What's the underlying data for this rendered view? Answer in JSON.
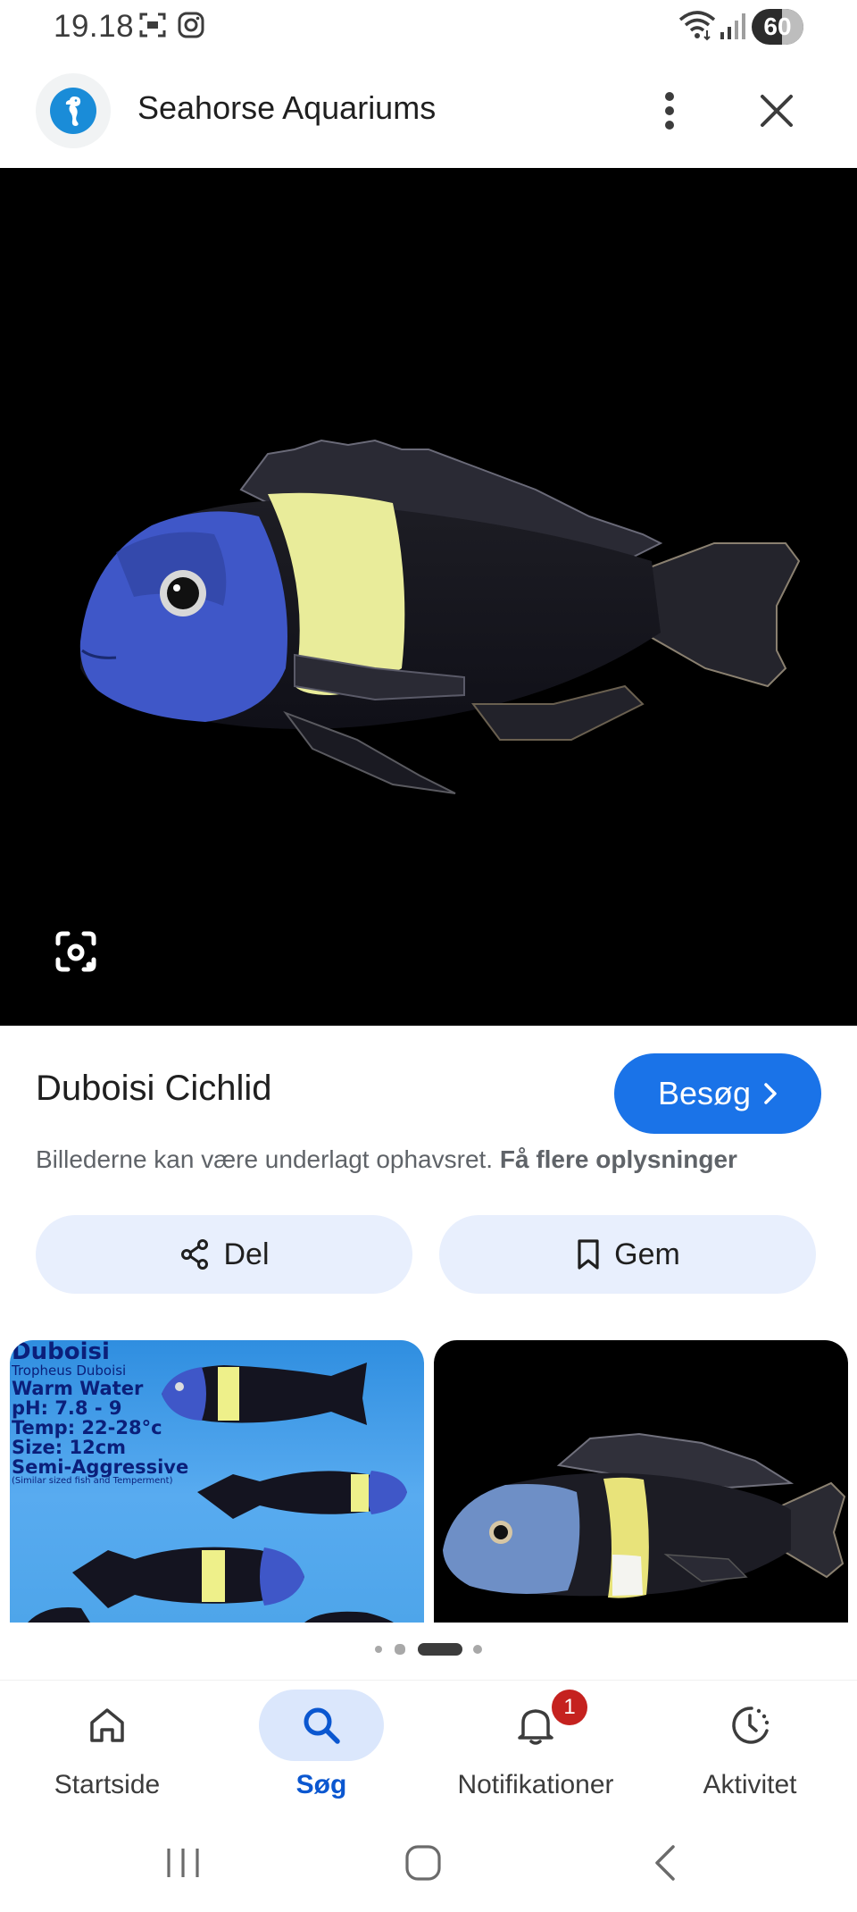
{
  "status_bar": {
    "time": "19.18",
    "battery": "60",
    "icons": [
      "screenshot-icon",
      "instagram-icon",
      "wifi-icon",
      "signal-icon",
      "battery-icon"
    ]
  },
  "header": {
    "site_name": "Seahorse Aquariums",
    "logo_icon": "seahorse-icon",
    "more_icon": "more-vertical-icon",
    "close_icon": "close-icon"
  },
  "hero": {
    "lens_icon": "google-lens-icon"
  },
  "result": {
    "title": "Duboisi Cichlid",
    "visit_label": "Besøg",
    "copyright_text": "Billederne kan være underlagt ophavsret.",
    "copyright_link": "Få flere oplysninger"
  },
  "actions": {
    "share_label": "Del",
    "save_label": "Gem"
  },
  "related": {
    "left_lines": [
      "Duboisi",
      "Tropheus Duboisi",
      "Warm Water",
      "pH: 7.8 - 9",
      "Temp: 22-28°c",
      "Size: 12cm",
      "Semi-Aggressive",
      "(Similar sized fish and Temperment)"
    ]
  },
  "bottom_nav": {
    "items": [
      {
        "label": "Startside",
        "icon": "home-icon"
      },
      {
        "label": "Søg",
        "icon": "search-icon"
      },
      {
        "label": "Notifikationer",
        "icon": "bell-icon",
        "badge": "1"
      },
      {
        "label": "Aktivitet",
        "icon": "activity-icon"
      }
    ]
  },
  "colors": {
    "accent": "#1a73e8",
    "pill_bg": "#e8effd",
    "active_nav": "#0b57d0",
    "badge": "#c5221f"
  }
}
